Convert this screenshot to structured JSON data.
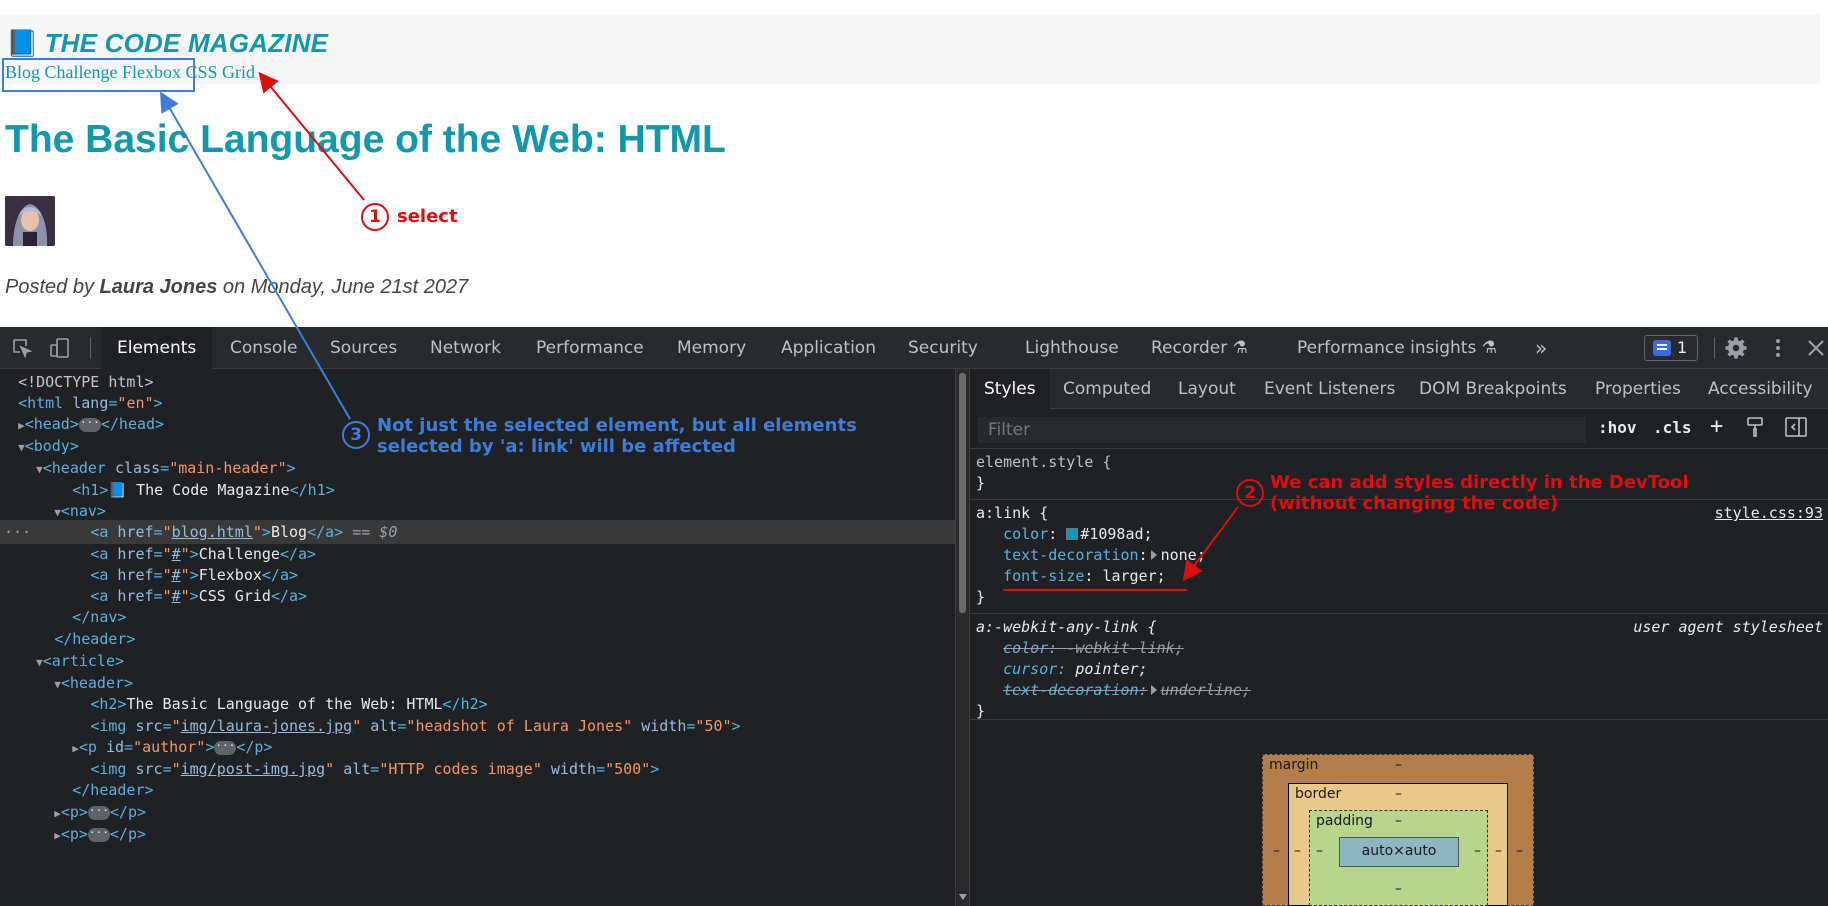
{
  "page": {
    "site_title": "THE CODE MAGAZINE",
    "nav": [
      "Blog",
      "Challenge",
      "Flexbox",
      "CSS Grid"
    ],
    "article_title": "The Basic Language of the Web: HTML",
    "posted_prefix": "Posted by ",
    "author": "Laura Jones",
    "posted_suffix": " on Monday, June 21st 2027"
  },
  "devtools": {
    "tabs": [
      "Elements",
      "Console",
      "Sources",
      "Network",
      "Performance",
      "Memory",
      "Application",
      "Security",
      "Lighthouse",
      "Recorder",
      "Performance insights"
    ],
    "more": "»",
    "issues_count": "1",
    "styles_tabs": [
      "Styles",
      "Computed",
      "Layout",
      "Event Listeners",
      "DOM Breakpoints",
      "Properties",
      "Accessibility"
    ],
    "filter_placeholder": "Filter",
    "hov": ":hov",
    "cls": ".cls",
    "element_style": "element.style {",
    "close_brace": "}",
    "rule1": {
      "selector": "a:link {",
      "source": "style.css:93",
      "decls": [
        {
          "prop": "color",
          "value": "#1098ad;"
        },
        {
          "prop": "text-decoration",
          "value": "none;"
        },
        {
          "prop": "font-size",
          "value": "larger;"
        }
      ]
    },
    "rule2": {
      "selector": "a:-webkit-any-link {",
      "source": "user agent stylesheet",
      "decls": [
        {
          "prop": "color",
          "value": "-webkit-link;"
        },
        {
          "prop": "cursor",
          "value": "pointer;"
        },
        {
          "prop": "text-decoration",
          "value": "underline;"
        }
      ]
    },
    "box_model": {
      "margin": "margin",
      "border": "border",
      "padding": "padding",
      "content": "auto×auto",
      "dash": "–"
    },
    "dom": {
      "doctype": "<!DOCTYPE html>",
      "html_lang": "en",
      "header_class": "main-header",
      "h1_text": "📘 The Code Magazine",
      "a1_href": "blog.html",
      "a1_text": "Blog",
      "a_href": "#",
      "a2_text": "Challenge",
      "a3_text": "Flexbox",
      "a4_text": "CSS Grid",
      "eq": "== $0",
      "h2_text": "The Basic Language of the Web: HTML",
      "img1_src": "img/laura-jones.jpg",
      "img1_alt": "headshot of Laura Jones",
      "img1_width": "50",
      "p_id": "author",
      "img2_src": "img/post-img.jpg",
      "img2_alt": "HTTP codes image",
      "img2_width": "500"
    }
  },
  "annotations": {
    "a1_num": "1",
    "a1_text": "select",
    "a2_num": "2",
    "a2_line1": "We can add styles directly in the DevTool",
    "a2_line2": "(without changing the code)",
    "a3_num": "3",
    "a3_line1": "Not just the selected element, but all elements",
    "a3_line2": "selected by 'a: link' will be affected"
  },
  "colors": {
    "brand": "#1098ad",
    "annotation_red": "#e00d0d",
    "annotation_blue": "#3b7dd8"
  }
}
